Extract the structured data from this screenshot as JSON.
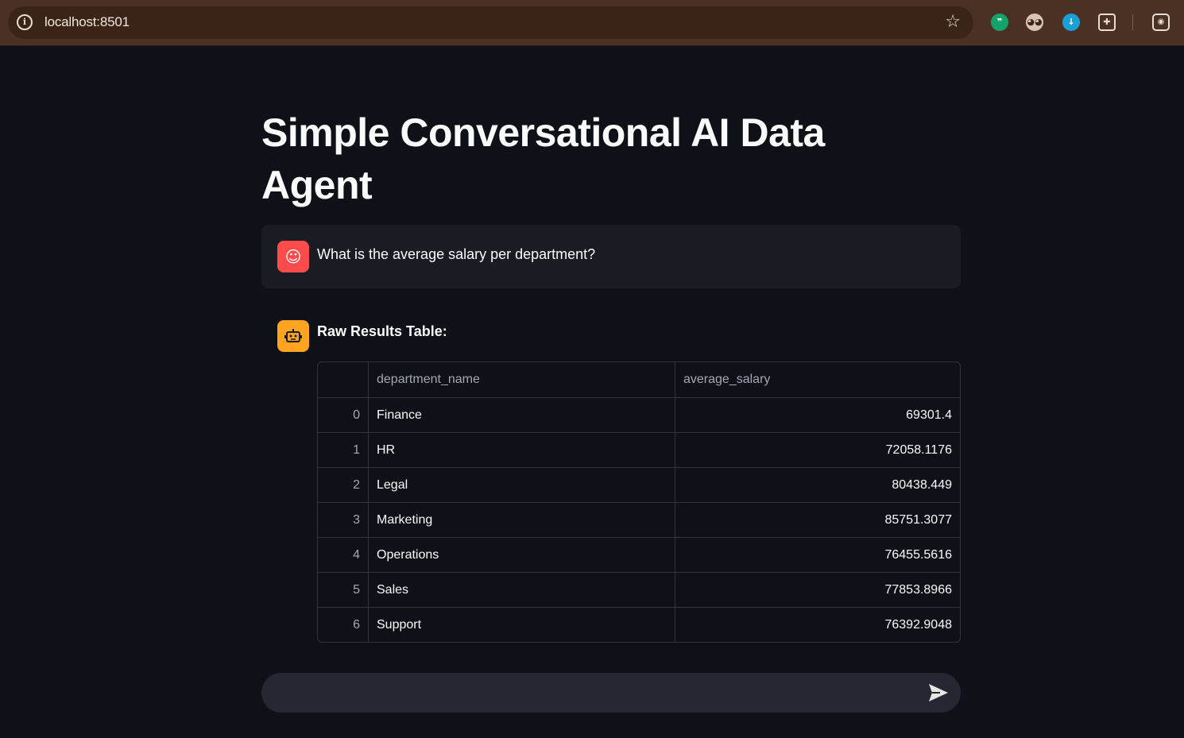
{
  "browser": {
    "url": "localhost:8501",
    "site_info_icon": "info-icon",
    "bookmark_icon": "star-icon",
    "extensions": [
      "quote-extension-icon",
      "owl-extension-icon",
      "download-extension-icon",
      "puzzle-extensions-icon",
      "screenshot-icon"
    ]
  },
  "page": {
    "title": "Simple Conversational AI Data Agent"
  },
  "chat": {
    "user_message": "What is the average salary per department?",
    "user_avatar_icon": "user-face-icon",
    "assistant_avatar_icon": "robot-icon",
    "assistant_heading": "Raw Results Table:",
    "table": {
      "columns": [
        "",
        "department_name",
        "average_salary"
      ],
      "rows": [
        {
          "index": "0",
          "department_name": "Finance",
          "average_salary": "69301.4"
        },
        {
          "index": "1",
          "department_name": "HR",
          "average_salary": "72058.1176"
        },
        {
          "index": "2",
          "department_name": "Legal",
          "average_salary": "80438.449"
        },
        {
          "index": "3",
          "department_name": "Marketing",
          "average_salary": "85751.3077"
        },
        {
          "index": "4",
          "department_name": "Operations",
          "average_salary": "76455.5616"
        },
        {
          "index": "5",
          "department_name": "Sales",
          "average_salary": "77853.8966"
        },
        {
          "index": "6",
          "department_name": "Support",
          "average_salary": "76392.9048"
        }
      ]
    },
    "input": {
      "value": "",
      "send_icon": "send-icon"
    }
  },
  "colors": {
    "background": "#0e1117",
    "user_avatar": "#ff4b4b",
    "assistant_avatar": "#ffa421",
    "browser_chrome": "#4a3123"
  }
}
